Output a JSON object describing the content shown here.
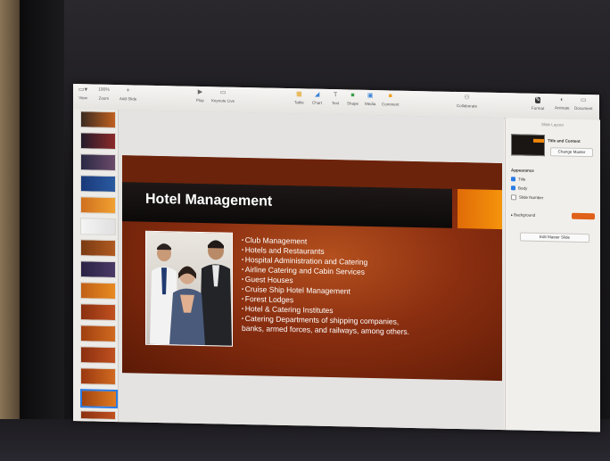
{
  "toolbar": {
    "view_label": "View",
    "zoom_value": "100%",
    "zoom_label": "Zoom",
    "add_slide_label": "Add Slide",
    "play_label": "Play",
    "keynote_live_label": "Keynote Live",
    "table_label": "Table",
    "chart_label": "Chart",
    "text_label": "Text",
    "shape_label": "Shape",
    "media_label": "Media",
    "comment_label": "Comment",
    "collaborate_label": "Collaborate",
    "format_label": "Format",
    "animate_label": "Animate",
    "document_label": "Document"
  },
  "slide": {
    "title": "Hotel Management",
    "bullets": [
      "Club Management",
      "Hotels and Restaurants",
      "Hospital Administration and Catering",
      "Airline Catering and Cabin Services",
      "Guest Houses",
      "Cruise Ship Hotel Management",
      "Forest Lodges",
      "Hotel & Catering Institutes",
      "Catering Departments of shipping companies,"
    ],
    "bullet_continuation": "banks, armed forces, and railways, among others."
  },
  "inspector": {
    "header": "Slide Layout",
    "master_name": "Title and Content",
    "change_master_label": "Change Master",
    "appearance_label": "Appearance",
    "title_option": "Title",
    "body_option": "Body",
    "slide_number_option": "Slide Number",
    "background_label": "Background",
    "edit_master_label": "Edit Master Slide"
  },
  "colors": {
    "accent_orange": "#f0870a",
    "selection_blue": "#2b7be4",
    "title_bar": "#151110"
  },
  "icons": [
    "view-icon",
    "add-slide-icon",
    "play-icon",
    "keynote-live-icon",
    "table-icon",
    "chart-icon",
    "text-icon",
    "shape-icon",
    "media-icon",
    "comment-icon",
    "collaborate-icon",
    "format-icon",
    "animate-icon",
    "document-icon"
  ]
}
